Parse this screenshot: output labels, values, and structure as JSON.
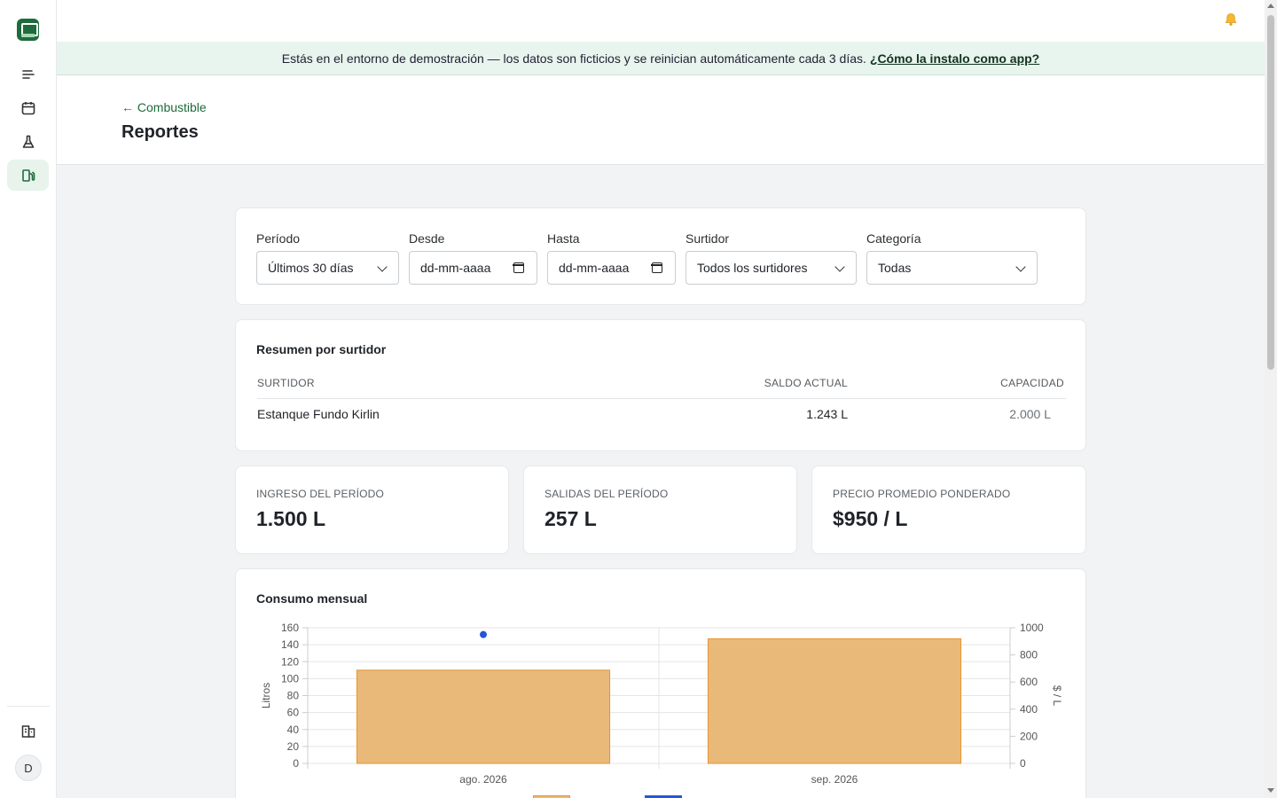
{
  "sidebar": {
    "items": [
      {
        "name": "menu-icon",
        "active": false
      },
      {
        "name": "calendar-icon",
        "active": false
      },
      {
        "name": "flask-icon",
        "active": false
      },
      {
        "name": "fuel-pump-icon",
        "active": true
      }
    ],
    "bottom_icon": "building-icon",
    "avatar_initial": "D"
  },
  "banner": {
    "text": "Estás en el entorno de demostración — los datos son ficticios y se reinician automáticamente cada 3 días.",
    "link": "¿Cómo la instalo como app?"
  },
  "header": {
    "back_link": "← Combustible",
    "title": "Reportes"
  },
  "filters": {
    "periodo": {
      "label": "Período",
      "value": "Últimos 30 días"
    },
    "desde": {
      "label": "Desde",
      "value": "dd-mm-aaaa"
    },
    "hasta": {
      "label": "Hasta",
      "value": "dd-mm-aaaa"
    },
    "surtidor": {
      "label": "Surtidor",
      "value": "Todos los surtidores"
    },
    "categoria": {
      "label": "Categoría",
      "value": "Todas"
    }
  },
  "summary": {
    "title": "Resumen por surtidor",
    "columns": [
      "SURTIDOR",
      "SALDO ACTUAL",
      "CAPACIDAD"
    ],
    "rows": [
      {
        "surtidor": "Estanque Fundo Kirlin",
        "saldo": "1.243 L",
        "capacidad": "2.000 L"
      }
    ]
  },
  "stats": [
    {
      "label": "INGRESO DEL PERÍODO",
      "value": "1.500 L"
    },
    {
      "label": "SALIDAS DEL PERÍODO",
      "value": "257 L"
    },
    {
      "label": "PRECIO PROMEDIO PONDERADO",
      "value": "$950 / L"
    }
  ],
  "chart_title": "Consumo mensual",
  "colors": {
    "accent": "#1e6b3c",
    "bar_fill": "#e9b97a",
    "bar_stroke": "#e8952e",
    "line": "#2456d6"
  },
  "chart_data": {
    "type": "bar",
    "categories": [
      "ago. 2026",
      "sep. 2026"
    ],
    "series": [
      {
        "type": "bar",
        "axis": "left",
        "values": [
          110,
          147
        ]
      },
      {
        "type": "line",
        "axis": "right",
        "values": [
          950,
          null
        ]
      }
    ],
    "ylabel": "Litros",
    "y2label": "$ / L",
    "ylim": [
      0,
      160
    ],
    "y2lim": [
      0,
      1000
    ],
    "yticks": [
      0,
      20,
      40,
      60,
      80,
      100,
      120,
      140,
      160
    ],
    "y2ticks": [
      0,
      200,
      400,
      600,
      800,
      1000
    ],
    "grid": true,
    "legend": "bottom"
  }
}
